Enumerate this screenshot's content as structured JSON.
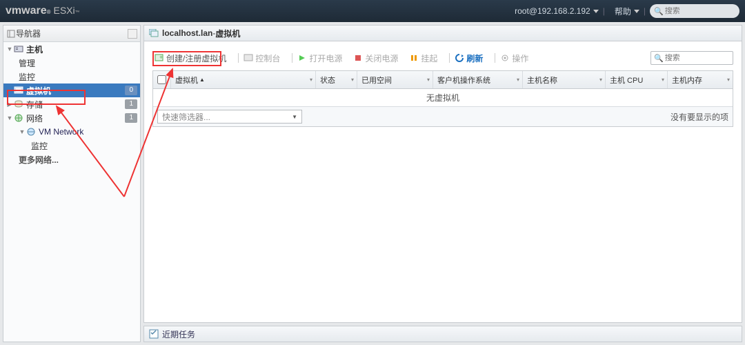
{
  "header": {
    "logo_vm": "vm",
    "logo_ware": "ware",
    "logo_esxi": "ESXi",
    "user": "root@192.168.2.192",
    "help": "帮助",
    "search_placeholder": "搜索"
  },
  "nav": {
    "title": "导航器",
    "items": {
      "host": {
        "label": "主机",
        "children": {
          "manage": "管理",
          "monitor": "监控"
        }
      },
      "vm": {
        "label": "虚拟机",
        "badge": "0"
      },
      "storage": {
        "label": "存储",
        "badge": "1"
      },
      "network": {
        "label": "网络",
        "badge": "1",
        "children": {
          "vmnetwork": {
            "label": "VM Network",
            "children": {
              "monitor": "监控"
            }
          },
          "more": "更多网络..."
        }
      }
    }
  },
  "content": {
    "breadcrumb_host": "localhost.lan",
    "breadcrumb_sep": " - ",
    "breadcrumb_page": "虚拟机",
    "toolbar": {
      "create": "创建/注册虚拟机",
      "console": "控制台",
      "poweron": "打开电源",
      "poweroff": "关闭电源",
      "suspend": "挂起",
      "refresh": "刷新",
      "actions": "操作",
      "search_placeholder": "搜索"
    },
    "grid": {
      "columns": {
        "vm": "虚拟机",
        "status": "状态",
        "used": "已用空间",
        "guest": "客户机操作系统",
        "hostname": "主机名称",
        "cpu": "主机 CPU",
        "mem": "主机内存"
      },
      "empty": "无虚拟机",
      "filter_placeholder": "快速筛选器...",
      "no_items": "没有要显示的项"
    },
    "tasks": {
      "label": "近期任务"
    }
  }
}
